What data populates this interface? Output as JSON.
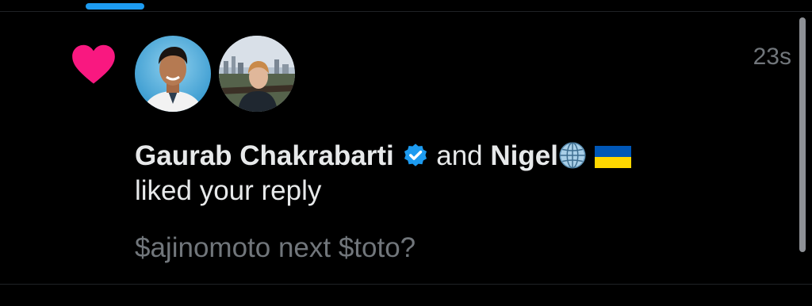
{
  "notification": {
    "timestamp": "23s",
    "user1_name": "Gaurab Chakrabarti",
    "connector": "and",
    "user2_name": "Nigel",
    "action": "liked your reply",
    "reply_text": "$ajinomoto next $toto?",
    "user1_verified": true,
    "user2_emoji": [
      "globe-icon",
      "ukraine-flag-icon"
    ]
  },
  "colors": {
    "background": "#000000",
    "heart": "#f91880",
    "verified": "#1d9bf0",
    "text_primary": "#e7e9ea",
    "text_secondary": "#71767b",
    "tab_indicator": "#1d9bf0"
  }
}
